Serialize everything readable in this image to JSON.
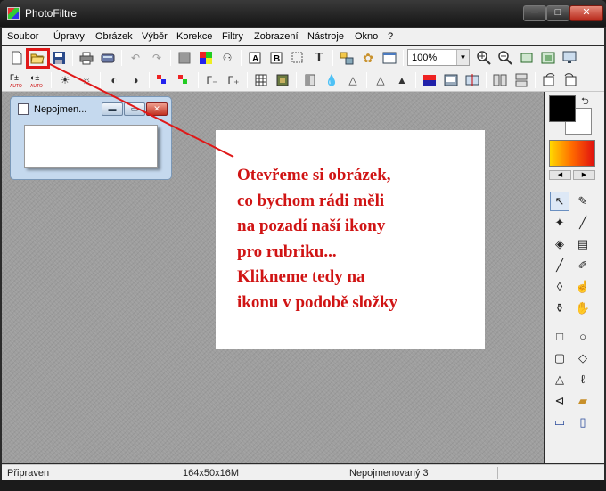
{
  "window": {
    "title": "PhotoFiltre",
    "minimize_label": "─",
    "maximize_label": "□",
    "close_label": "✕"
  },
  "menu": [
    "Soubor",
    "Úpravy",
    "Obrázek",
    "Výběr",
    "Korekce",
    "Filtry",
    "Zobrazení",
    "Nástroje",
    "Okno",
    "?"
  ],
  "toolbar": {
    "zoom_value": "100%",
    "icons_row1": [
      "new-icon",
      "open-folder-icon",
      "save-icon",
      "print-icon",
      "scan-icon",
      "undo-icon",
      "redo-icon",
      "stop-icon",
      "palette-icon",
      "bitmap-icon",
      "image-size-icon",
      "canvas-size-icon",
      "crop-icon",
      "text-icon",
      "plugin-icon",
      "gear-icon",
      "explorer-icon",
      "zoom-in-icon",
      "zoom-out-icon",
      "fit-image-icon",
      "actual-size-icon",
      "fullscreen-icon"
    ],
    "icons_row2": [
      "auto-levels-icon",
      "auto-contrast-icon",
      "brightness-down-icon",
      "brightness-up-icon",
      "contrast-down-icon",
      "contrast-up-icon",
      "saturation-down-icon",
      "saturation-up-icon",
      "gamma-down-icon",
      "gamma-up-icon",
      "grid-icon",
      "pattern-icon",
      "blur-icon",
      "drop-icon",
      "sharpen-icon",
      "sharpen-more-icon",
      "desaturate-icon",
      "invert-icon",
      "sepia-icon",
      "flip-horizontal-icon",
      "flip-vertical-icon",
      "rotate-left-icon",
      "rotate-right-icon"
    ]
  },
  "document": {
    "title": "Nepojmen...",
    "min_label": "▬",
    "max_label": "▭",
    "close_label": "✕"
  },
  "annotation": {
    "lines": [
      "Otevřeme si obrázek,",
      "co bychom rádi měli",
      "na pozadí naší ikony",
      "pro rubriku...",
      "Klikneme tedy na",
      "ikonu v podobě složky"
    ],
    "color": "#d01414"
  },
  "colors": {
    "foreground": "#000000",
    "background": "#ffffff"
  },
  "tools": [
    "selection-arrow-icon",
    "eyedropper-icon",
    "magic-wand-icon",
    "line-icon",
    "fill-bucket-icon",
    "spray-icon",
    "brush-icon",
    "advanced-brush-icon",
    "blur-drop-icon",
    "smudge-icon",
    "stamp-icon",
    "hand-icon",
    "rectangle-icon",
    "ellipse-icon",
    "rounded-rectangle-icon",
    "diamond-icon",
    "triangle-icon",
    "lasso-icon",
    "polygon-icon",
    "open-folder-shape-icon",
    "selection-horizontal-icon",
    "selection-vertical-icon"
  ],
  "status": {
    "state": "Připraven",
    "dimensions": "164x50x16M",
    "document_name": "Nepojmenovaný 3"
  }
}
